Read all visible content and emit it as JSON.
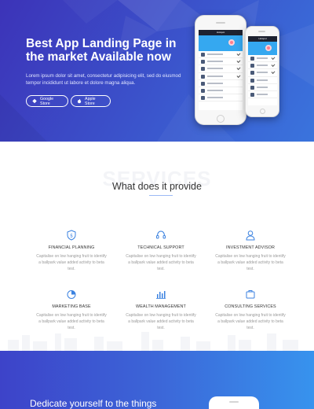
{
  "hero": {
    "title": "Best App Landing Page in the market Available now",
    "description": "Lorem ipsum dolor sit amet, consectetur adipisicing elit, sed do eiusmod tempor incididunt ut labore et dolore magna aliqua.",
    "google_label": "Google Store",
    "apple_label": "Apple Store",
    "phone_header_1": "Hotspot",
    "phone_header_2": "Hotspot"
  },
  "services": {
    "watermark": "SERVICES",
    "title": "What does it provide",
    "items": [
      {
        "icon": "shield-dollar-icon",
        "title": "FINANCIAL PLANNING",
        "text": "Capitalise on low hanging fruit to identify a ballpark value added activity to beta test."
      },
      {
        "icon": "headset-icon",
        "title": "TECHNICAL SUPPORT",
        "text": "Capitalise on low hanging fruit to identify a ballpark value added activity to beta test."
      },
      {
        "icon": "user-icon",
        "title": "INVESTMENT ADVISOR",
        "text": "Capitalise on low hanging fruit to identify a ballpark value added activity to beta test."
      },
      {
        "icon": "pie-chart-icon",
        "title": "MARKETING BASE",
        "text": "Capitalise on low hanging fruit to identify a ballpark value added activity to beta test."
      },
      {
        "icon": "bar-chart-icon",
        "title": "WEALTH MANAGEMENT",
        "text": "Capitalise on low hanging fruit to identify a ballpark value added activity to beta test."
      },
      {
        "icon": "briefcase-icon",
        "title": "CONSULTING SERVICES",
        "text": "Capitalise on low hanging fruit to identify a ballpark value added activity to beta test."
      }
    ]
  },
  "band": {
    "title": "Dedicate yourself to the things"
  },
  "colors": {
    "hero_start": "#3c33b8",
    "hero_end": "#3a74dd",
    "accent": "#3b82e0",
    "band_end": "#3793ee"
  }
}
